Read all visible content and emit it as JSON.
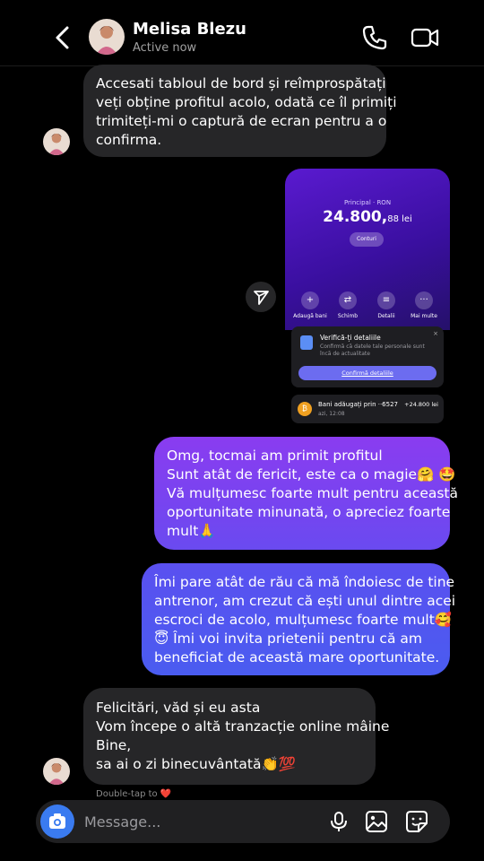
{
  "header": {
    "contact_name": "Melisa Blezu",
    "status": "Active now",
    "icons": [
      "back-chevron-icon",
      "phone-icon",
      "video-camera-icon"
    ]
  },
  "messages": [
    {
      "direction": "incoming",
      "lines": [
        "Accesati tabloul de bord și reîmprospătați",
        "veți obține profitul acolo, odată ce îl primiți",
        "trimiteți-mi o captură de ecran pentru a o",
        "confirma."
      ]
    },
    {
      "direction": "outgoing",
      "type": "image",
      "screenshot": {
        "subtitle": "Principal · RON",
        "amount_main": "24.800,",
        "amount_decimals": "88 lei",
        "accounts_button": "Conturi",
        "actions": [
          "Adaugă bani",
          "Schimb",
          "Detalii",
          "Mai multe"
        ],
        "verify_title": "Verifică-ți detaliile",
        "verify_text": "Confirmă că datele tale personale sunt încă de actualitate",
        "verify_button": "Confirmă detaliile",
        "transaction_title": "Bani adăugați prin ··6527",
        "transaction_time": "azi, 12:08",
        "transaction_amount": "+24.800 lei"
      }
    },
    {
      "direction": "outgoing",
      "lines": [
        "Omg, tocmai am primit profitul",
        "Sunt atât de fericit, este ca o magie🤗 🤩",
        "Vă mulțumesc foarte mult pentru această",
        "oportunitate minunată, o apreciez foarte",
        "mult🙏"
      ]
    },
    {
      "direction": "outgoing",
      "lines": [
        "Îmi pare atât de rău că mă îndoiesc de tine",
        "antrenor, am crezut că ești unul dintre acei",
        "escroci de acolo, mulțumesc foarte mult🥰",
        "😇 Îmi voi invita prietenii pentru că am",
        "beneficiat de această mare oportunitate."
      ]
    },
    {
      "direction": "incoming",
      "lines": [
        "Felicitări, văd și eu asta",
        "Vom începe o altă tranzacție online mâine",
        "Bine,",
        "sa ai o zi binecuvântată👏💯"
      ]
    }
  ],
  "hint": "Double-tap to ❤️",
  "composer": {
    "placeholder": "Message...",
    "icons": [
      "camera-icon",
      "microphone-icon",
      "gallery-icon",
      "sticker-icon"
    ]
  },
  "colors": {
    "background": "#000000",
    "incoming_bubble": "#262628",
    "outgoing_gradient_top": "#8a3cf0",
    "outgoing_gradient_bottom": "#4a5cf0",
    "camera_button": "#3a7bf0"
  }
}
